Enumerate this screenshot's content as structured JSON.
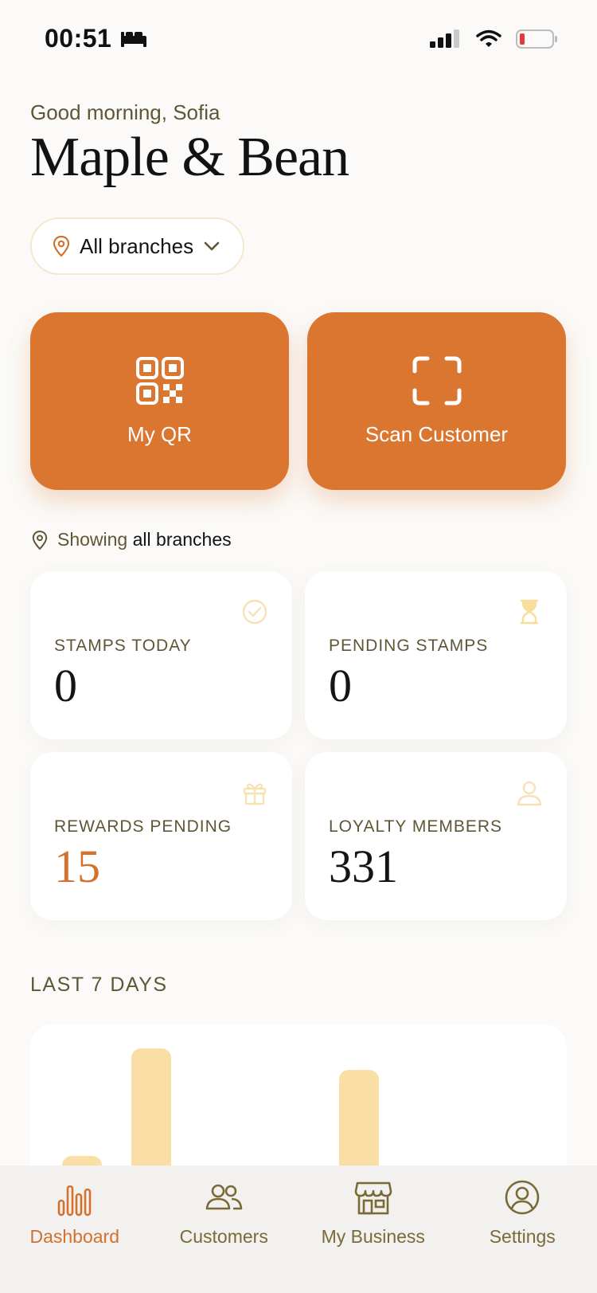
{
  "status_bar": {
    "time": "00:51"
  },
  "header": {
    "greeting": "Good morning, Sofia",
    "business_name": "Maple & Bean",
    "branch_selector": "All branches"
  },
  "actions": [
    {
      "label": "My QR",
      "icon": "qr-code-icon"
    },
    {
      "label": "Scan Customer",
      "icon": "scan-frame-icon"
    }
  ],
  "showing": {
    "prefix": "Showing",
    "value": "all branches"
  },
  "stats": [
    {
      "label": "STAMPS TODAY",
      "value": "0",
      "icon": "check-circle-icon"
    },
    {
      "label": "PENDING STAMPS",
      "value": "0",
      "icon": "hourglass-icon"
    },
    {
      "label": "REWARDS PENDING",
      "value": "15",
      "icon": "gift-icon"
    },
    {
      "label": "LOYALTY MEMBERS",
      "value": "331",
      "icon": "user-icon"
    }
  ],
  "chart_section": {
    "title": "LAST 7 DAYS"
  },
  "chart_data": {
    "type": "bar",
    "categories": [],
    "values": [
      5,
      10,
      1,
      4,
      9,
      0,
      0
    ],
    "ylim": [
      0,
      10
    ],
    "color": "#F9DFA6",
    "note_visibility": "chart partially hidden behind tab bar"
  },
  "colors": {
    "accent": "#DB7631",
    "bar": "#F9DFA6",
    "muted_text": "#5F5635",
    "background": "#FBFAF8"
  },
  "tabs": [
    {
      "label": "Dashboard",
      "icon": "bar-chart-icon",
      "active": true
    },
    {
      "label": "Customers",
      "icon": "users-icon",
      "active": false
    },
    {
      "label": "My Business",
      "icon": "store-icon",
      "active": false
    },
    {
      "label": "Settings",
      "icon": "profile-circle-icon",
      "active": false
    }
  ]
}
